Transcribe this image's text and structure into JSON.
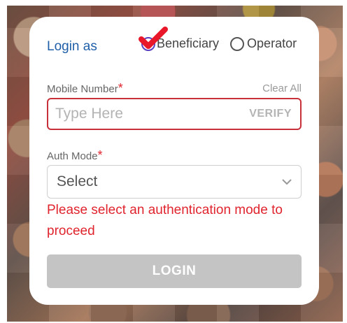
{
  "form": {
    "login_as_label": "Login as",
    "role_options": [
      {
        "label": "Beneficiary",
        "selected": true
      },
      {
        "label": "Operator",
        "selected": false
      }
    ],
    "mobile": {
      "label": "Mobile Number",
      "required_mark": "*",
      "clear_label": "Clear All",
      "placeholder": "Type Here",
      "value": "",
      "verify_label": "VERIFY"
    },
    "auth_mode": {
      "label": "Auth Mode",
      "required_mark": "*",
      "selected_value": "Select"
    },
    "error_message": "Please select an authentication mode to proceed",
    "login_button": "LOGIN"
  },
  "colors": {
    "accent_blue": "#1f5fa8",
    "error_red": "#e0242e",
    "check_red": "#e8182a",
    "disabled_button": "#c4c4c4"
  },
  "icons": {
    "selected_check": "red-checkmark-icon",
    "dropdown": "chevron-down-icon"
  }
}
